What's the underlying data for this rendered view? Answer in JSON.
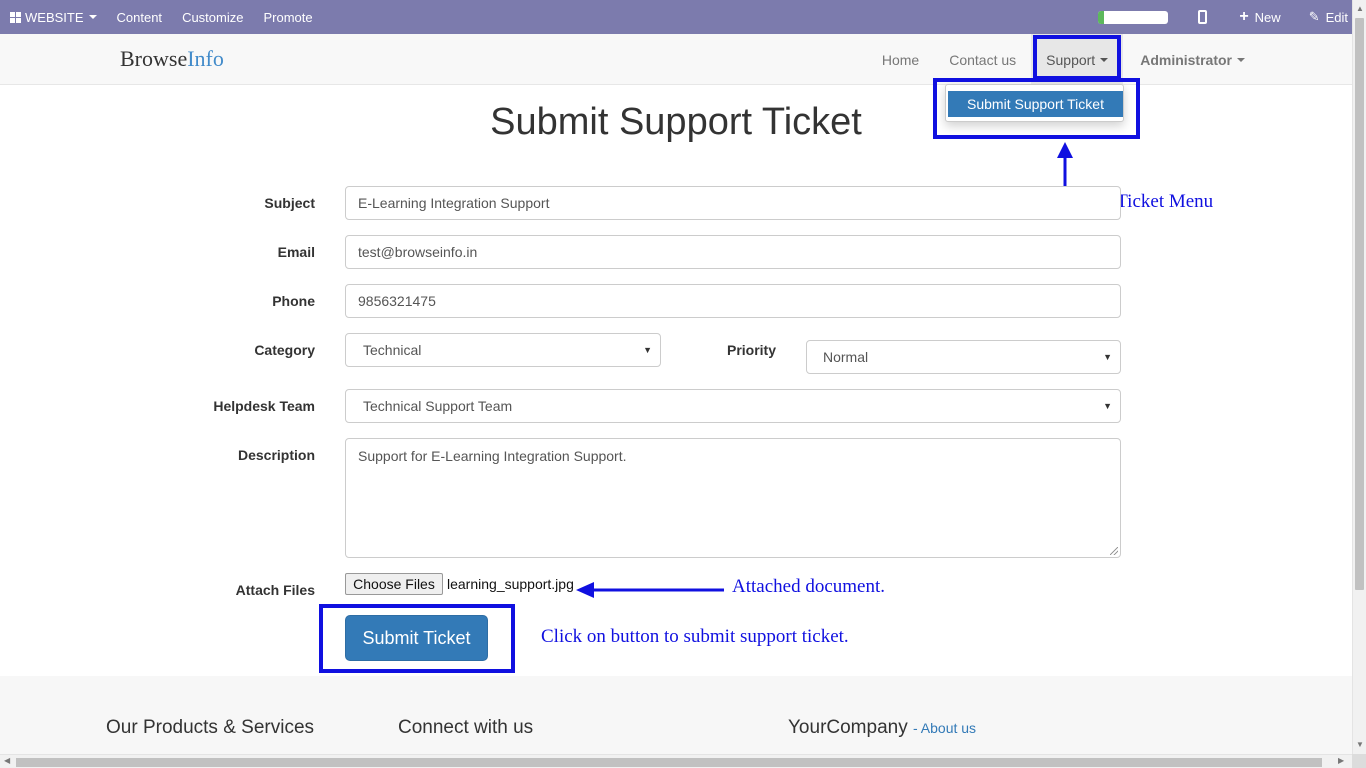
{
  "topbar": {
    "website_label": "WEBSITE",
    "content_label": "Content",
    "customize_label": "Customize",
    "promote_label": "Promote",
    "progress_fraction": 0.08,
    "new_label": "New",
    "edit_label": "Edit",
    "bg_color": "#7c7bad"
  },
  "navbar": {
    "brand_part1": "Browse",
    "brand_part2": "Info",
    "home_label": "Home",
    "contact_label": "Contact us",
    "support_label": "Support",
    "admin_label": "Administrator"
  },
  "dropdown": {
    "item_label": "Submit Support Ticket"
  },
  "page": {
    "title": "Submit Support Ticket"
  },
  "form": {
    "subject_label": "Subject",
    "subject_value": "E-Learning Integration Support",
    "email_label": "Email",
    "email_value": "test@browseinfo.in",
    "phone_label": "Phone",
    "phone_value": "9856321475",
    "category_label": "Category",
    "category_value": "Technical",
    "priority_label": "Priority",
    "priority_value": "Normal",
    "team_label": "Helpdesk Team",
    "team_value": "Technical Support Team",
    "description_label": "Description",
    "description_value": "Support for E-Learning Integration Support.",
    "attach_label": "Attach Files",
    "choose_files_label": "Choose Files",
    "file_name": "learning_support.jpg",
    "submit_label": "Submit Ticket"
  },
  "annotations": {
    "menu_note": "Submit Support Ticket Menu",
    "attach_note": "Attached document.",
    "submit_note": "Click on button to submit support ticket.",
    "highlight_color": "#1010e0"
  },
  "footer": {
    "products_title": "Our Products & Services",
    "connect_title": "Connect with us",
    "company_title": "YourCompany",
    "about_link": "- About us"
  }
}
